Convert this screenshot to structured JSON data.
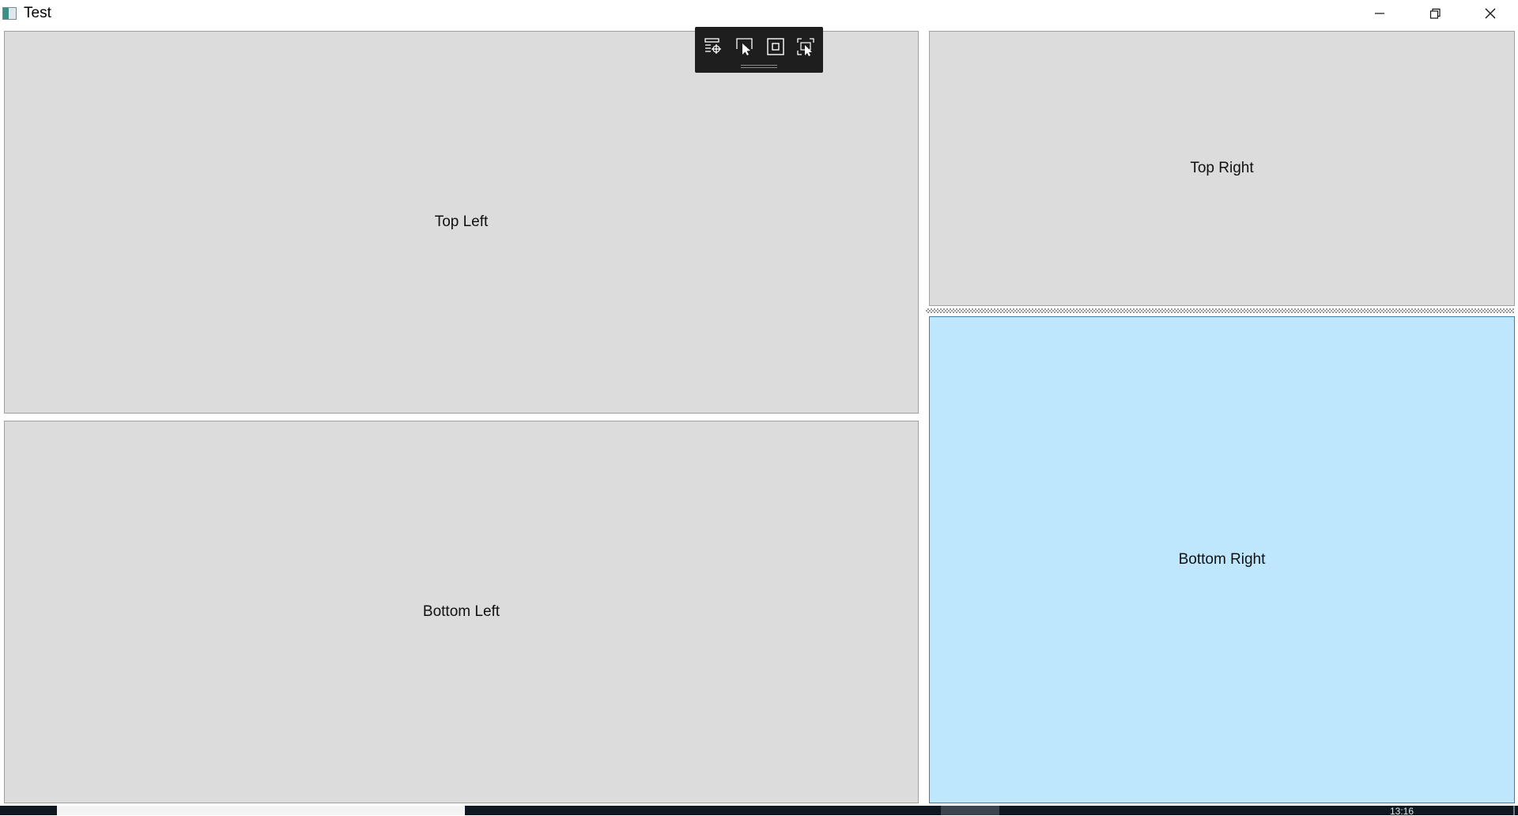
{
  "window": {
    "title": "Test",
    "buttons": {
      "minimize": "minimize-icon",
      "restore": "restore-icon",
      "close": "close-icon"
    }
  },
  "panes": {
    "top_left": {
      "label": "Top Left"
    },
    "bottom_left": {
      "label": "Bottom Left"
    },
    "top_right": {
      "label": "Top Right"
    },
    "bottom_right": {
      "label": "Bottom Right",
      "selected": true
    }
  },
  "debug_toolbar": {
    "items": [
      {
        "icon": "live-visual-tree-icon"
      },
      {
        "icon": "select-element-icon"
      },
      {
        "icon": "display-layout-adorners-icon"
      },
      {
        "icon": "track-focused-element-icon"
      }
    ]
  },
  "taskbar": {
    "clock": "13:16"
  },
  "colors": {
    "pane_background": "#dcdcdc",
    "selected_pane_background": "#bee6fd",
    "toolbar_background": "#1e1e1e",
    "taskbar_background": "#0f1720"
  }
}
